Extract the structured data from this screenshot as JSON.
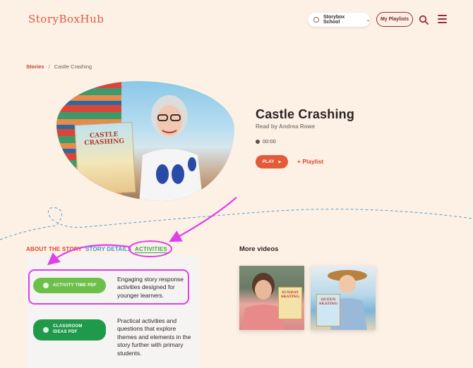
{
  "header": {
    "logo": "StoryBoxHub",
    "school_selector": "Storybox School",
    "my_playlists": "My Playlists"
  },
  "breadcrumb": {
    "root": "Stories",
    "separator": "/",
    "current": "Castle Crashing"
  },
  "story": {
    "book_cover_title": "CASTLE CRASHING",
    "title": "Castle Crashing",
    "read_by": "Read by Andrea Rowe",
    "duration": "00:00",
    "play_label": "PLAY",
    "add_playlist_label": "+ Playlist"
  },
  "tabs": {
    "about": "ABOUT THE STORY",
    "details": "STORY DETAILS",
    "activities": "ACTIVITIES"
  },
  "activities": [
    {
      "button": "ACTIVITY TIME PDF",
      "description": "Engaging story response activities designed for younger learners."
    },
    {
      "button": "CLASSROOM IDEAS PDF",
      "description": "Practical activities and questions that explore themes and elements in the story further with primary students."
    }
  ],
  "more_videos": {
    "title": "More videos",
    "items": [
      {
        "book_title": "SUNDAY SKATING"
      },
      {
        "book_title": "QUEEN SKATING"
      }
    ]
  },
  "colors": {
    "background": "#fdf1e6",
    "accent_orange": "#e45b3a",
    "playlist_maroon": "#9a2a3a",
    "tab_blue": "#3a9ad0",
    "tab_green": "#2fa85a",
    "annotation_magenta": "#e040e8"
  }
}
